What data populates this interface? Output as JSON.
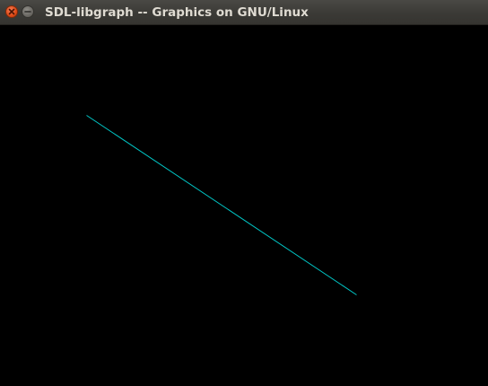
{
  "window": {
    "title": "SDL-libgraph -- Graphics on GNU/Linux",
    "buttons": {
      "close_icon": "close-icon",
      "minimize_icon": "minimize-icon"
    }
  },
  "canvas": {
    "background_color": "#000000",
    "line": {
      "color": "#00c8c8"
    }
  }
}
